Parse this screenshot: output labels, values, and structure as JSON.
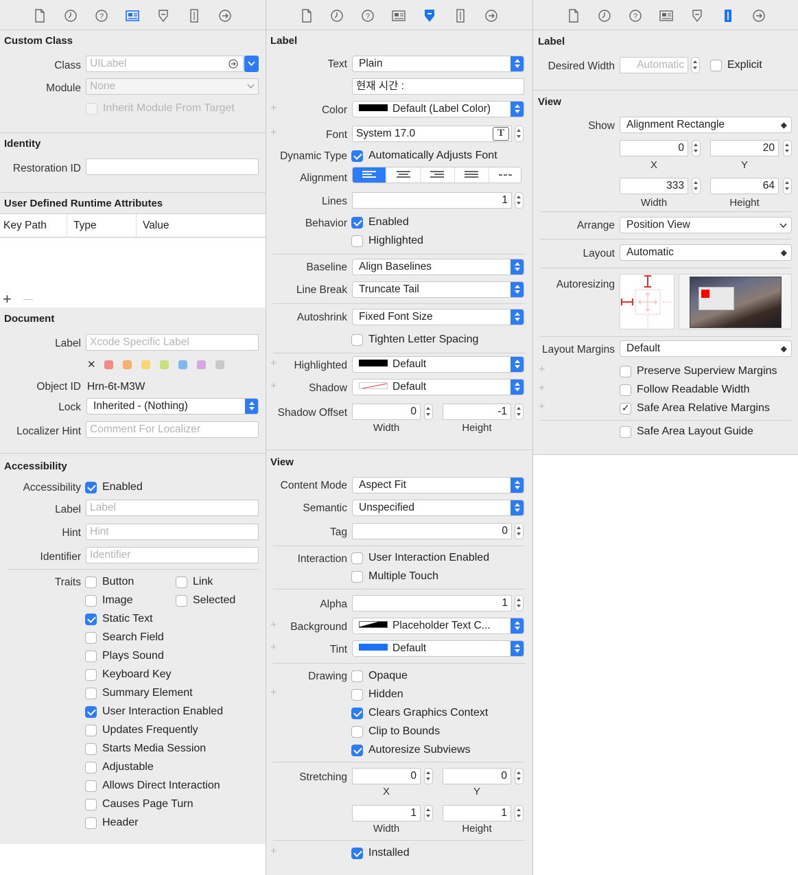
{
  "panel1": {
    "custom_class": {
      "title": "Custom Class",
      "class_label": "Class",
      "class_placeholder": "UILabel",
      "module_label": "Module",
      "module_placeholder": "None",
      "inherit_label": "Inherit Module From Target"
    },
    "identity": {
      "title": "Identity",
      "restoration_label": "Restoration ID",
      "restoration_value": ""
    },
    "runtime": {
      "title": "User Defined Runtime Attributes",
      "col_keypath": "Key Path",
      "col_type": "Type",
      "col_value": "Value",
      "add": "+",
      "remove": "—"
    },
    "document": {
      "title": "Document",
      "label_label": "Label",
      "label_placeholder": "Xcode Specific Label",
      "clear_tag": "✕",
      "tag_colors": [
        "#f28b82",
        "#f6b26b",
        "#f7d774",
        "#c7e27a",
        "#7fb7f0",
        "#d7a8e0",
        "#c9c9c9"
      ],
      "object_id_label": "Object ID",
      "object_id_value": "Hrn-6t-M3W",
      "lock_label": "Lock",
      "lock_value": "Inherited - (Nothing)",
      "localizer_label": "Localizer Hint",
      "localizer_placeholder": "Comment For Localizer"
    },
    "accessibility": {
      "title": "Accessibility",
      "acc_label": "Accessibility",
      "acc_enabled": "Enabled",
      "label_label": "Label",
      "label_placeholder": "Label",
      "hint_label": "Hint",
      "hint_placeholder": "Hint",
      "identifier_label": "Identifier",
      "identifier_placeholder": "Identifier",
      "traits_label": "Traits",
      "trait_button": "Button",
      "trait_link": "Link",
      "trait_image": "Image",
      "trait_selected": "Selected",
      "trait_static_text": "Static Text",
      "trait_search_field": "Search Field",
      "trait_plays_sound": "Plays Sound",
      "trait_keyboard_key": "Keyboard Key",
      "trait_summary": "Summary Element",
      "trait_user_interaction": "User Interaction Enabled",
      "trait_updates": "Updates Frequently",
      "trait_media": "Starts Media Session",
      "trait_adjustable": "Adjustable",
      "trait_direct": "Allows Direct Interaction",
      "trait_page_turn": "Causes Page Turn",
      "trait_header": "Header"
    }
  },
  "panel2": {
    "label_section": {
      "title": "Label",
      "text_label": "Text",
      "text_type": "Plain",
      "text_value": "현재 시간 :",
      "color_label": "Color",
      "color_value": "Default (Label Color)",
      "font_label": "Font",
      "font_value": "System 17.0",
      "font_btn": "T",
      "dynamic_label": "Dynamic Type",
      "dynamic_value": "Automatically Adjusts Font",
      "alignment_label": "Alignment",
      "lines_label": "Lines",
      "lines_value": "1",
      "behavior_label": "Behavior",
      "behavior_enabled": "Enabled",
      "behavior_highlighted": "Highlighted",
      "baseline_label": "Baseline",
      "baseline_value": "Align Baselines",
      "linebreak_label": "Line Break",
      "linebreak_value": "Truncate Tail",
      "autoshrink_label": "Autoshrink",
      "autoshrink_value": "Fixed Font Size",
      "tighten_label": "Tighten Letter Spacing",
      "highlighted_label": "Highlighted",
      "highlighted_value": "Default",
      "shadow_label": "Shadow",
      "shadow_value": "Default",
      "shadow_offset_label": "Shadow Offset",
      "shadow_offset_w": "0",
      "shadow_offset_h": "-1",
      "width_label": "Width",
      "height_label": "Height",
      "plus": "+"
    },
    "view_section": {
      "title": "View",
      "content_mode_label": "Content Mode",
      "content_mode_value": "Aspect Fit",
      "semantic_label": "Semantic",
      "semantic_value": "Unspecified",
      "tag_label": "Tag",
      "tag_value": "0",
      "interaction_label": "Interaction",
      "interaction_user": "User Interaction Enabled",
      "interaction_multi": "Multiple Touch",
      "alpha_label": "Alpha",
      "alpha_value": "1",
      "background_label": "Background",
      "background_value": "Placeholder Text C...",
      "tint_label": "Tint",
      "tint_value": "Default",
      "drawing_label": "Drawing",
      "drawing_opaque": "Opaque",
      "drawing_hidden": "Hidden",
      "drawing_clears": "Clears Graphics Context",
      "drawing_clip": "Clip to Bounds",
      "drawing_autoresize": "Autoresize Subviews",
      "stretching_label": "Stretching",
      "stretch_x": "0",
      "stretch_y": "0",
      "stretch_w": "1",
      "stretch_h": "1",
      "x_label": "X",
      "y_label": "Y",
      "width_label": "Width",
      "height_label": "Height",
      "installed_label": "Installed"
    }
  },
  "panel3": {
    "label_section": {
      "title": "Label",
      "desired_width_label": "Desired Width",
      "desired_width_placeholder": "Automatic",
      "explicit_label": "Explicit"
    },
    "view_section": {
      "title": "View",
      "show_label": "Show",
      "show_value": "Alignment Rectangle",
      "x_value": "0",
      "y_value": "20",
      "width_value": "333",
      "height_value": "64",
      "x_label": "X",
      "y_label": "Y",
      "width_label": "Width",
      "height_label": "Height",
      "arrange_label": "Arrange",
      "arrange_value": "Position View",
      "layout_label": "Layout",
      "layout_value": "Automatic",
      "autoresizing_label": "Autoresizing",
      "margins_label": "Layout Margins",
      "margins_value": "Default",
      "preserve_label": "Preserve Superview Margins",
      "readable_label": "Follow Readable Width",
      "safe_area_margins_label": "Safe Area Relative Margins",
      "safe_area_guide_label": "Safe Area Layout Guide",
      "plus": "+"
    }
  },
  "toolbar": {
    "icons": [
      "file-icon",
      "history-icon",
      "help-icon",
      "identity-icon",
      "attributes-icon",
      "size-icon",
      "connections-icon"
    ]
  }
}
